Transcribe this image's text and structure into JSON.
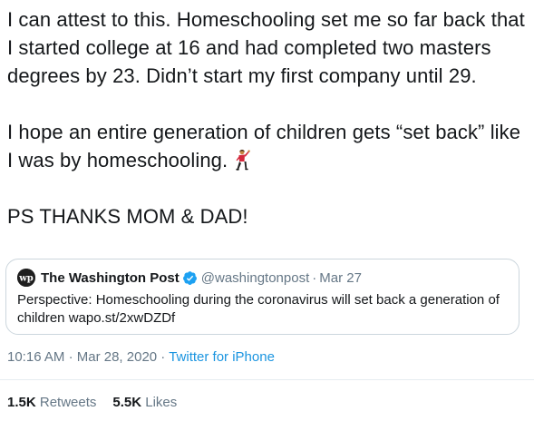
{
  "tweet": {
    "paragraphs": [
      "I can attest to this. Homeschooling set me so far back that I started college at 16 and had completed two masters degrees by 23. Didn’t start my first company until 29.",
      "I hope an entire generation of children gets “set back” like I was by homeschooling.",
      "PS THANKS MOM & DAD!"
    ],
    "emoji": "man-dancing-emoji"
  },
  "quoted_tweet": {
    "name": "The Washington Post",
    "handle": "@washingtonpost",
    "separator": "·",
    "date": "Mar 27",
    "text": "Perspective: Homeschooling during the coronavirus will set back a generation of children wapo.st/2xwDZDf",
    "avatar_icon": "washington-post-logo",
    "verified_icon": "verified-badge-icon",
    "avatar_letters": "wp"
  },
  "meta": {
    "time": "10:16 AM",
    "separator1": "·",
    "date": "Mar 28, 2020",
    "separator2": "·",
    "source": "Twitter for iPhone"
  },
  "stats": {
    "retweets_count": "1.5K",
    "retweets_label": "Retweets",
    "likes_count": "5.5K",
    "likes_label": "Likes"
  },
  "colors": {
    "text": "#14171a",
    "secondary": "#657786",
    "link": "#1b95e0",
    "border": "#ccd6dd",
    "verified": "#1da1f2"
  }
}
